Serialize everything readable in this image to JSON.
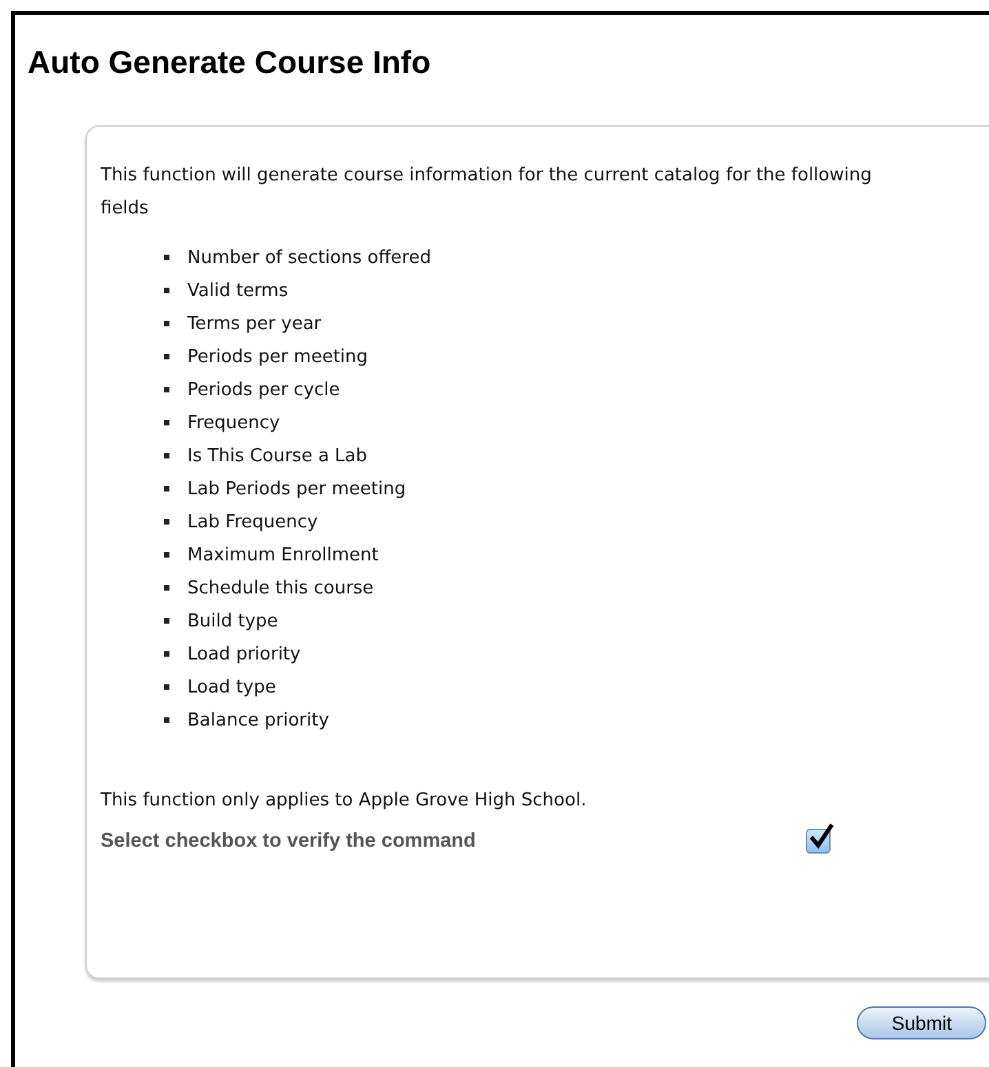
{
  "title": "Auto Generate Course Info",
  "intro": "This function will generate course information for the current catalog for the following fields",
  "fields": [
    "Number of sections offered",
    "Valid terms",
    "Terms per year",
    "Periods per meeting",
    "Periods per cycle",
    "Frequency",
    "Is This Course a Lab",
    "Lab Periods per meeting",
    "Lab Frequency",
    "Maximum Enrollment",
    "Schedule this course",
    "Build type",
    "Load priority",
    "Load type",
    "Balance priority"
  ],
  "note": "This function only applies to Apple Grove High School.",
  "verify": {
    "label": "Select checkbox to verify the command",
    "checked": true
  },
  "submit": "Submit"
}
